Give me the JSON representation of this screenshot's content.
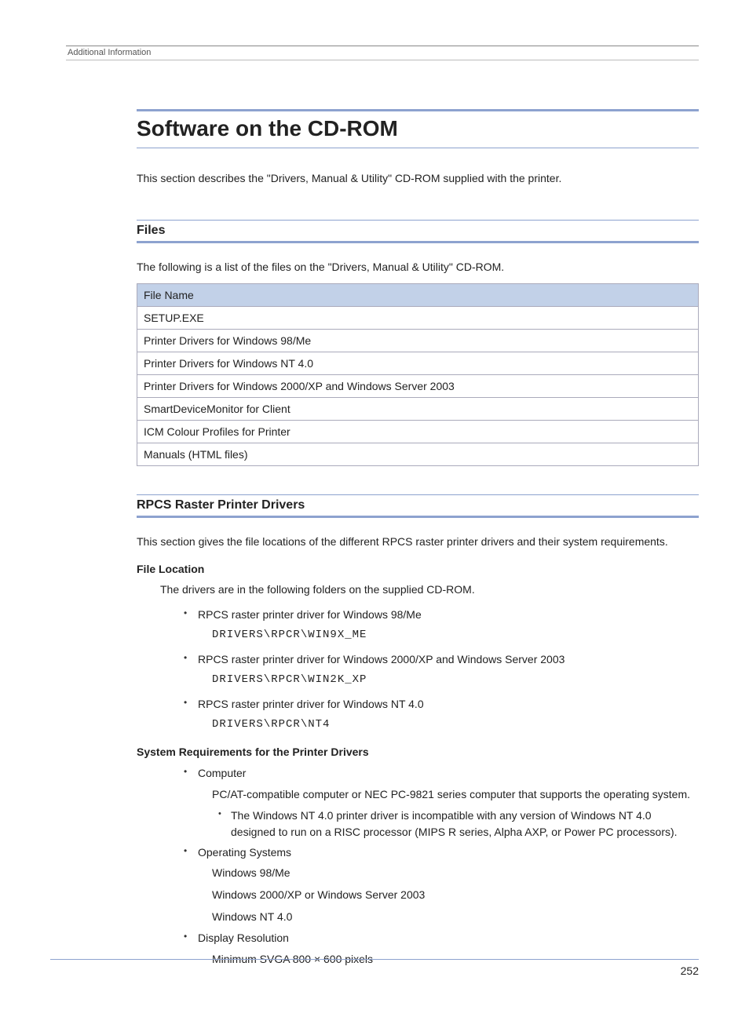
{
  "header": {
    "running": "Additional Information"
  },
  "title": "Software on the CD-ROM",
  "intro": "This section describes the \"Drivers, Manual & Utility\" CD-ROM supplied with the printer.",
  "files": {
    "heading": "Files",
    "intro": "The following is a list of the files on the \"Drivers, Manual & Utility\" CD-ROM.",
    "column": "File Name",
    "rows": [
      "SETUP.EXE",
      "Printer Drivers for Windows 98/Me",
      "Printer Drivers for Windows NT 4.0",
      "Printer Drivers for Windows 2000/XP and Windows Server 2003",
      "SmartDeviceMonitor for Client",
      "ICM Colour Profiles for Printer",
      "Manuals (HTML files)"
    ]
  },
  "rpcs": {
    "heading": "RPCS Raster Printer Drivers",
    "intro": "This section gives the file locations of the different RPCS raster printer drivers and their system requirements.",
    "file_location_heading": "File Location",
    "file_location_intro": "The drivers are in the following folders on the supplied CD-ROM.",
    "drivers": [
      {
        "label": "RPCS raster printer driver for Windows 98/Me",
        "path": "DRIVERS\\RPCR\\WIN9X_ME"
      },
      {
        "label": "RPCS raster printer driver for Windows 2000/XP and Windows Server 2003",
        "path": "DRIVERS\\RPCR\\WIN2K_XP"
      },
      {
        "label": "RPCS raster printer driver for Windows NT 4.0",
        "path": "DRIVERS\\RPCR\\NT4"
      }
    ],
    "sysreq_heading": "System Requirements for the Printer Drivers",
    "sysreq": {
      "computer_label": "Computer",
      "computer_desc": "PC/AT-compatible computer or NEC PC-9821 series computer that supports the operating system.",
      "computer_note": "The Windows NT 4.0 printer driver is incompatible with any version of Windows NT 4.0 designed to run on a RISC processor (MIPS R series, Alpha AXP, or Power PC processors).",
      "os_label": "Operating Systems",
      "os_list": [
        "Windows 98/Me",
        "Windows 2000/XP or Windows Server 2003",
        "Windows NT 4.0"
      ],
      "display_label": "Display Resolution",
      "display_desc": "Minimum SVGA 800 × 600 pixels"
    }
  },
  "page_number": "252"
}
